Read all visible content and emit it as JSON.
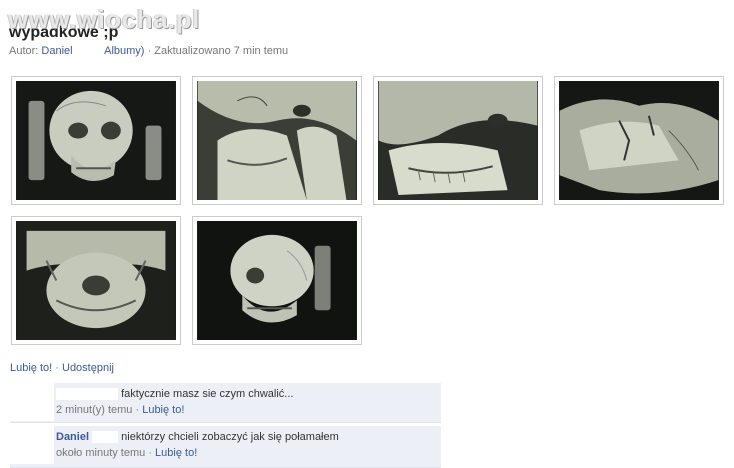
{
  "watermark": "www.wiocha.pl",
  "album": {
    "title": "wypadkowe ;p",
    "author_prefix": "Autor:",
    "author_name": "Daniel",
    "albums_link": "Albumy)",
    "updated": "· Zaktualizowano 7 min temu"
  },
  "photos": [
    {
      "name": "skull-front-photo",
      "subject": "ct-skull-front"
    },
    {
      "name": "skull-side-photo",
      "subject": "ct-skull-side"
    },
    {
      "name": "jaw-closeup-photo",
      "subject": "ct-jaw-closeup"
    },
    {
      "name": "jaw-fracture-photo",
      "subject": "ct-jaw-fracture"
    },
    {
      "name": "skull-base-photo",
      "subject": "ct-skull-base"
    },
    {
      "name": "skull-profile-photo",
      "subject": "ct-skull-profile"
    }
  ],
  "actions": {
    "like": "Lubię to!",
    "separator": "·",
    "share": "Udostępnij"
  },
  "comments": [
    {
      "author": "",
      "text": "faktycznie masz sie czym chwalić...",
      "time": "2 minut(y) temu",
      "like": "Lubię to!"
    },
    {
      "author": "Daniel",
      "text": "niektórzy chcieli zobaczyć jak się połamałem",
      "time": "około minuty temu",
      "like": "Lubię to!"
    }
  ]
}
